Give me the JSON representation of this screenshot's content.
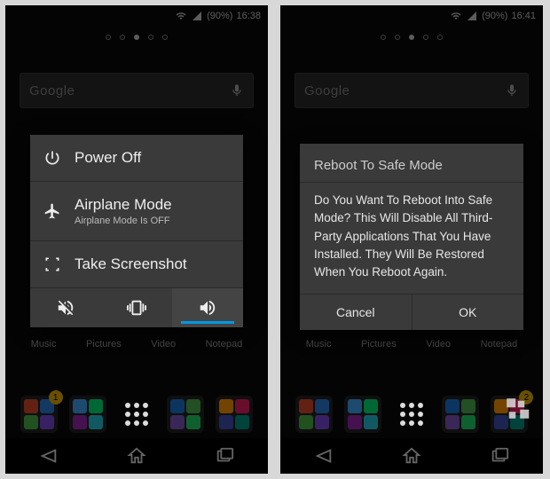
{
  "left": {
    "status": {
      "battery": "(90%)",
      "time": "16:38"
    },
    "search": {
      "placeholder": "Google"
    },
    "power_menu": {
      "power_off": "Power Off",
      "airplane_label": "Airplane Mode",
      "airplane_sub": "Airplane Mode Is OFF",
      "screenshot": "Take Screenshot"
    },
    "app_labels": [
      "Music",
      "Pictures",
      "Video",
      "Notepad"
    ],
    "badge": "1"
  },
  "right": {
    "status": {
      "battery": "(90%)",
      "time": "16:41"
    },
    "search": {
      "placeholder": "Google"
    },
    "dialog": {
      "title": "Reboot To Safe Mode",
      "body": "Do You Want To Reboot Into Safe Mode? This Will Disable All Third-Party Applications That You Have Installed. They Will Be Restored When You Reboot Again.",
      "cancel": "Cancel",
      "ok": "OK"
    },
    "app_labels": [
      "Music",
      "Pictures",
      "Video",
      "Notepad"
    ],
    "badge": "2"
  }
}
